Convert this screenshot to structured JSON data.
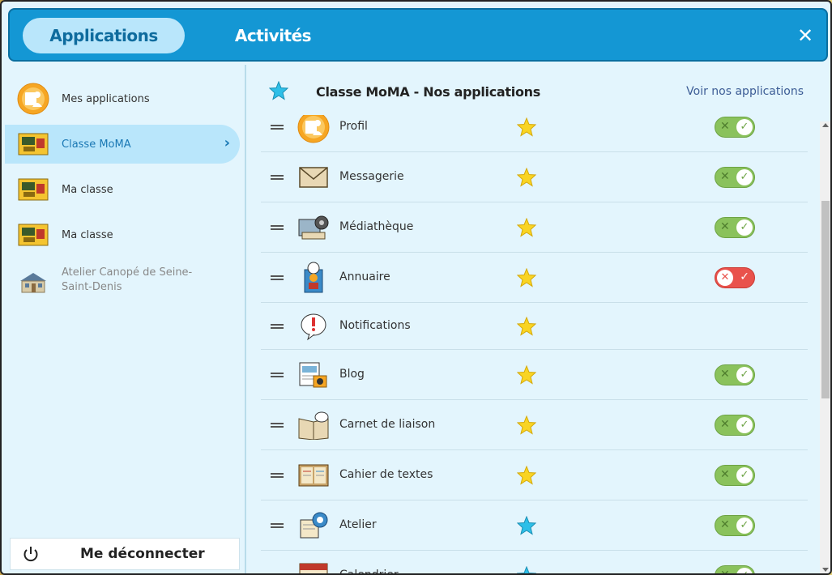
{
  "header": {
    "tab_applications": "Applications",
    "tab_activites": "Activités",
    "close_glyph": "✕",
    "accent_color": "#1497d4"
  },
  "sidebar": {
    "items": [
      {
        "label": "Mes applications",
        "icon": "profile-icon",
        "active": false
      },
      {
        "label": "Classe MoMA",
        "icon": "classroom-icon",
        "active": true
      },
      {
        "label": "Ma classe",
        "icon": "classroom-icon",
        "active": false
      },
      {
        "label": "Ma classe",
        "icon": "classroom-icon",
        "active": false
      },
      {
        "label": "Atelier Canopé de Seine-Saint-Denis",
        "icon": "school-building-icon",
        "active": false
      }
    ],
    "logout_label": "Me déconnecter"
  },
  "main": {
    "title": "Classe MoMA - Nos applications",
    "link": "Voir nos applications",
    "apps": [
      {
        "name": "Profil",
        "icon": "profile-icon",
        "favorite": "yellow",
        "toggle": "on"
      },
      {
        "name": "Messagerie",
        "icon": "envelope-icon",
        "favorite": "yellow",
        "toggle": "on"
      },
      {
        "name": "Médiathèque",
        "icon": "media-library-icon",
        "favorite": "yellow",
        "toggle": "on"
      },
      {
        "name": "Annuaire",
        "icon": "directory-icon",
        "favorite": "yellow",
        "toggle": "off"
      },
      {
        "name": "Notifications",
        "icon": "notification-icon",
        "favorite": "yellow",
        "toggle": "none"
      },
      {
        "name": "Blog",
        "icon": "blog-icon",
        "favorite": "yellow",
        "toggle": "on"
      },
      {
        "name": "Carnet de liaison",
        "icon": "notebook-icon",
        "favorite": "yellow",
        "toggle": "on"
      },
      {
        "name": "Cahier de textes",
        "icon": "homework-book-icon",
        "favorite": "yellow",
        "toggle": "on"
      },
      {
        "name": "Atelier",
        "icon": "workshop-icon",
        "favorite": "blue",
        "toggle": "on"
      },
      {
        "name": "Calendrier",
        "icon": "calendar-icon",
        "favorite": "blue",
        "toggle": "on"
      }
    ]
  }
}
